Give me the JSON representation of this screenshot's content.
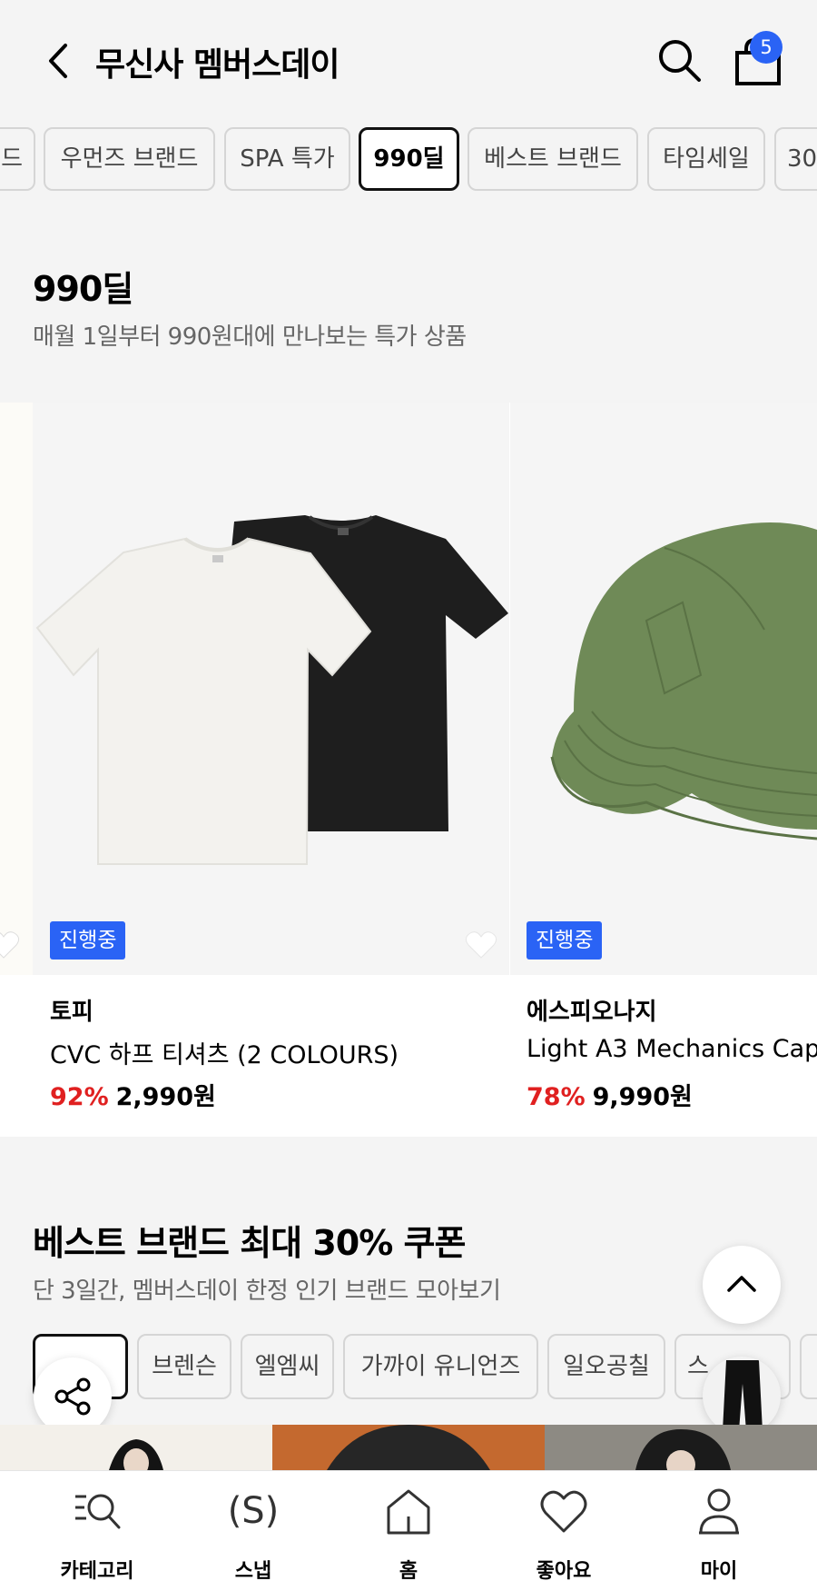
{
  "header": {
    "title": "무신사 멤버스데이",
    "cart_count": "5"
  },
  "tabs": [
    "드",
    "우먼즈 브랜드",
    "SPA 특가",
    "990딜",
    "베스트 브랜드",
    "타임세일",
    "30"
  ],
  "deal_section": {
    "title": "990딜",
    "subtitle": "매월 1일부터 990원대에 만나보는 특가 상품",
    "products": [
      {
        "badge": "진행중",
        "brand": "토피",
        "name": "CVC 하프 티셔츠 (2 COLOURS)",
        "discount": "92%",
        "price": "2,990원"
      },
      {
        "badge": "진행중",
        "brand": "에스피오나지",
        "name": "Light A3 Mechanics Cap",
        "discount": "78%",
        "price": "9,990원"
      }
    ],
    "left_partial_name": "."
  },
  "best_section": {
    "title": "베스트 브랜드 최대 30% 쿠폰",
    "subtitle": "단 3일간, 멤버스데이 한정 인기 브랜드 모아보기",
    "brands": [
      "",
      "브렌슨",
      "엘엠씨",
      "가까이 유니언즈",
      "일오공칠",
      "스",
      ""
    ]
  },
  "bottom_nav": [
    {
      "label": "카테고리",
      "icon": "category-search-icon"
    },
    {
      "label": "스냅",
      "icon": "snap-icon",
      "glyph": "(S)"
    },
    {
      "label": "홈",
      "icon": "home-icon"
    },
    {
      "label": "좋아요",
      "icon": "heart-icon"
    },
    {
      "label": "마이",
      "icon": "person-icon"
    }
  ],
  "colors": {
    "accent_blue": "#2a63f5",
    "discount_red": "#e02020",
    "background": "#f4f4f4"
  }
}
